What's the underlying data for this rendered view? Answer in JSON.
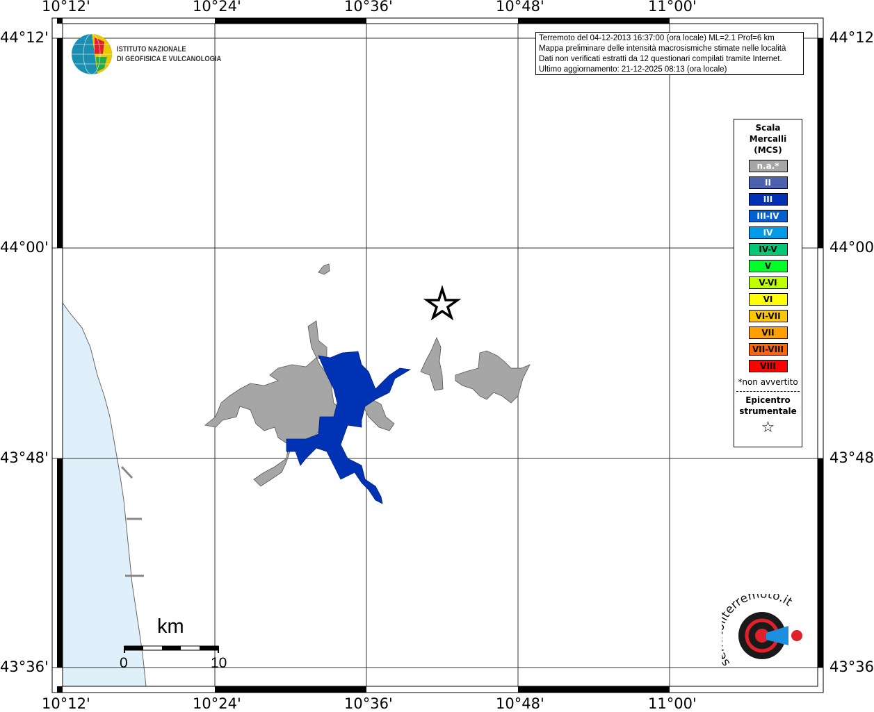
{
  "map": {
    "lon_labels": [
      "10°12'",
      "10°24'",
      "10°36'",
      "10°48'",
      "11°00'"
    ],
    "lat_labels": [
      "44°12'",
      "44°00'",
      "43°48'",
      "43°36'"
    ],
    "colors": {
      "sea": "#dff0fb",
      "na": "#a6a6a6",
      "III": "#0033b4",
      "star": "#000000"
    }
  },
  "info": {
    "line1": "Terremoto del 04-12-2013 16:37:00 (ora locale) ML=2.1 Prof=6 km",
    "line2": "Mappa preliminare delle intensità macrosismiche stimate nelle località",
    "line3": "Dati non verificati estratti da 12 questionari compilati tramite Internet.",
    "line4": "Ultimo aggiornamento: 21-12-2025 08:13 (ora locale)"
  },
  "logo_ingv": {
    "line1": "ISTITUTO NAZIONALE",
    "line2": "DI GEOFISICA E VULCANOLOGIA"
  },
  "logo_hst": {
    "text": "www.haisentitoilterremoto.it"
  },
  "legend": {
    "title": [
      "Scala",
      "Mercalli",
      "(MCS)"
    ],
    "items": [
      {
        "label": "n.a.*",
        "color": "#a6a6a6",
        "text": "#ffffff"
      },
      {
        "label": "II",
        "color": "#4c62ad",
        "text": "#ffffff"
      },
      {
        "label": "III",
        "color": "#0030b4",
        "text": "#ffffff"
      },
      {
        "label": "III-IV",
        "color": "#0060d0",
        "text": "#ffffff"
      },
      {
        "label": "IV",
        "color": "#009be6",
        "text": "#ffffff"
      },
      {
        "label": "IV-V",
        "color": "#00c878",
        "text": "#000000"
      },
      {
        "label": "V",
        "color": "#00ff28",
        "text": "#000000"
      },
      {
        "label": "V-VI",
        "color": "#c0ff00",
        "text": "#000000"
      },
      {
        "label": "VI",
        "color": "#ffff00",
        "text": "#000000"
      },
      {
        "label": "VI-VII",
        "color": "#ffc800",
        "text": "#000000"
      },
      {
        "label": "VII",
        "color": "#ffa000",
        "text": "#000000"
      },
      {
        "label": "VII-VIII",
        "color": "#ff6400",
        "text": "#000000"
      },
      {
        "label": "VIII",
        "color": "#ff0000",
        "text": "#000000"
      }
    ],
    "note": "*non avvertito",
    "epicenter": [
      "Epicentro",
      "strumentale"
    ],
    "star": "☆"
  },
  "scalebar": {
    "unit": "km",
    "start": "0",
    "end": "10"
  }
}
